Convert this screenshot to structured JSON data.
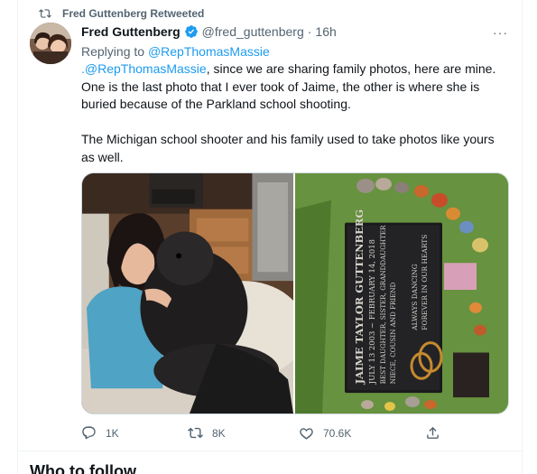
{
  "retweet": {
    "label": "Fred Guttenberg Retweeted"
  },
  "tweet": {
    "author_name": "Fred Guttenberg",
    "author_handle": "@fred_guttenberg",
    "separator": "·",
    "time": "16h",
    "more": "···",
    "replying_prefix": "Replying to",
    "replying_to": "@RepThomasMassie",
    "text_mention": ".@RepThomasMassie",
    "text_line1_rest": ", since we are sharing family photos, here are mine.",
    "text_line2": "One is the last photo that I ever took of Jaime, the other is where she is",
    "text_line3": "buried because of the Parkland school shooting.",
    "text_line4": "The Michigan school shooter and his family used to take photos like yours",
    "text_line5": "as well."
  },
  "grave": {
    "top1": "ALWAYS DANCING",
    "top2": "FOREVER IN OUR HEARTS",
    "name": "JAIME TAYLOR GUTTENBERG",
    "dates": "JULY 13 2003 ~ FEBRUARY 14, 2018",
    "line3": "BEST DAUGHTER, SISTER, GRANDDAUGHTER",
    "line4": "NIECE, COUSIN AND FRIEND"
  },
  "actions": {
    "reply_count": "1K",
    "retweet_count": "8K",
    "like_count": "70.6K"
  },
  "sidebar": {
    "who_to_follow": "Who to follow"
  },
  "colors": {
    "accent": "#1d9bf0",
    "muted": "#536471",
    "text": "#0f1419"
  }
}
